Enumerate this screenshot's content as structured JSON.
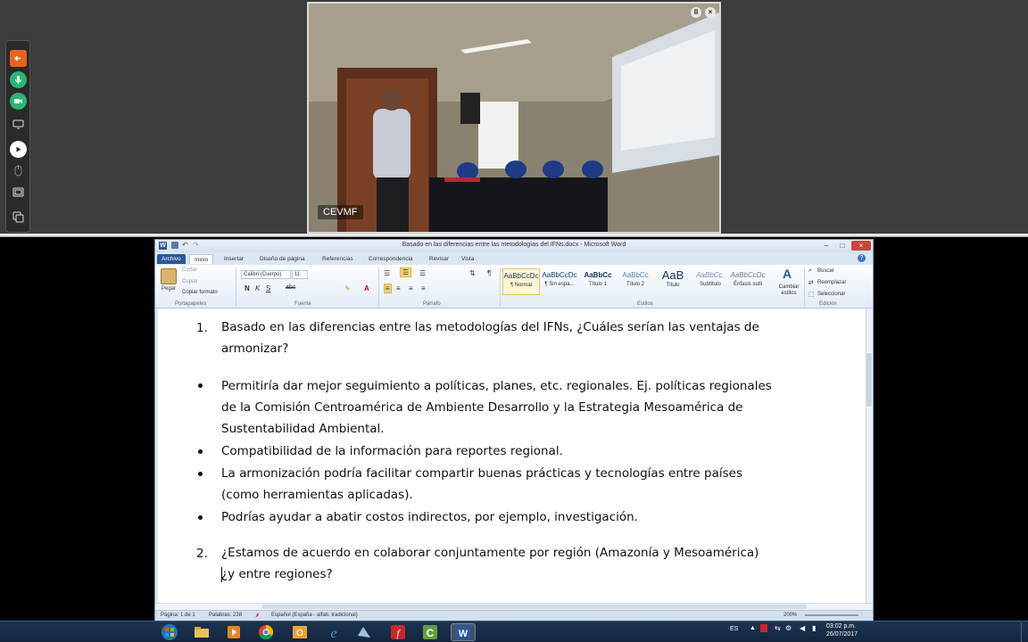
{
  "conference": {
    "video_label": "CEVMF"
  },
  "word": {
    "window_title": "Basado en las diferencias entre las metodologías del IFNs.docx - Microsoft Word",
    "menu_tabs": [
      "Archivo",
      "Inicio",
      "Insertar",
      "Diseño de página",
      "Referencias",
      "Correspondencia",
      "Revisar",
      "Vista"
    ],
    "ribbon": {
      "clipboard": {
        "paste": "Pegar",
        "cut": "Cortar",
        "copy": "Copiar",
        "format_painter": "Copiar formato",
        "group": "Portapapeles"
      },
      "font": {
        "name": "Calibri (Cuerpo)",
        "size": "11",
        "group": "Fuente"
      },
      "paragraph": {
        "group": "Párrafo"
      },
      "styles": {
        "items": [
          {
            "sample": "AaBbCcDc",
            "name": "¶ Normal"
          },
          {
            "sample": "AaBbCcDc",
            "name": "¶ Sin espa..."
          },
          {
            "sample": "AaBbCc",
            "name": "Título 1"
          },
          {
            "sample": "AaBbCc",
            "name": "Título 2"
          },
          {
            "sample": "AaB",
            "name": "Título"
          },
          {
            "sample": "AaBbCc.",
            "name": "Subtítulo"
          },
          {
            "sample": "AaBbCcDc",
            "name": "Énfasis sutil"
          }
        ],
        "change_styles": "Cambiar estilos",
        "group": "Estilos"
      },
      "editing": {
        "find": "Buscar",
        "replace": "Reemplazar",
        "select": "Seleccionar",
        "group": "Edición"
      }
    },
    "document": {
      "q1_number": "1.",
      "q1_line1": "Basado en las diferencias entre las metodologías del IFNs, ¿Cuáles serían las ventajas de",
      "q1_line2": "armonizar?",
      "b1_line1": "Permitiría dar mejor seguimiento a políticas, planes, etc. regionales. Ej. políticas regionales",
      "b1_line2": "de la Comisión Centroamérica de Ambiente Desarrollo  y la Estrategia Mesoamérica de",
      "b1_line3": "Sustentabilidad Ambiental.",
      "b2_line1": "Compatibilidad de la información para reportes regional.",
      "b3_line1": "La armonización podría facilitar compartir buenas prácticas y tecnologías entre países",
      "b3_line2": "(como herramientas aplicadas).",
      "b4_line1": "Podrías ayudar a abatir costos indirectos, por ejemplo, investigación.",
      "q2_number": "2.",
      "q2_line1": "¿Estamos de acuerdo en colaborar conjuntamente por región (Amazonía y Mesoamérica)",
      "q2_line2": "¿y entre regiones?"
    },
    "status_bar": {
      "page": "Página: 1 de 1",
      "words": "Palabras: 238",
      "language": "Español (España - alfab. tradicional)",
      "zoom": "200%"
    }
  },
  "taskbar": {
    "language": "ES",
    "time": "03:02 p.m.",
    "date": "26/07/2017"
  }
}
